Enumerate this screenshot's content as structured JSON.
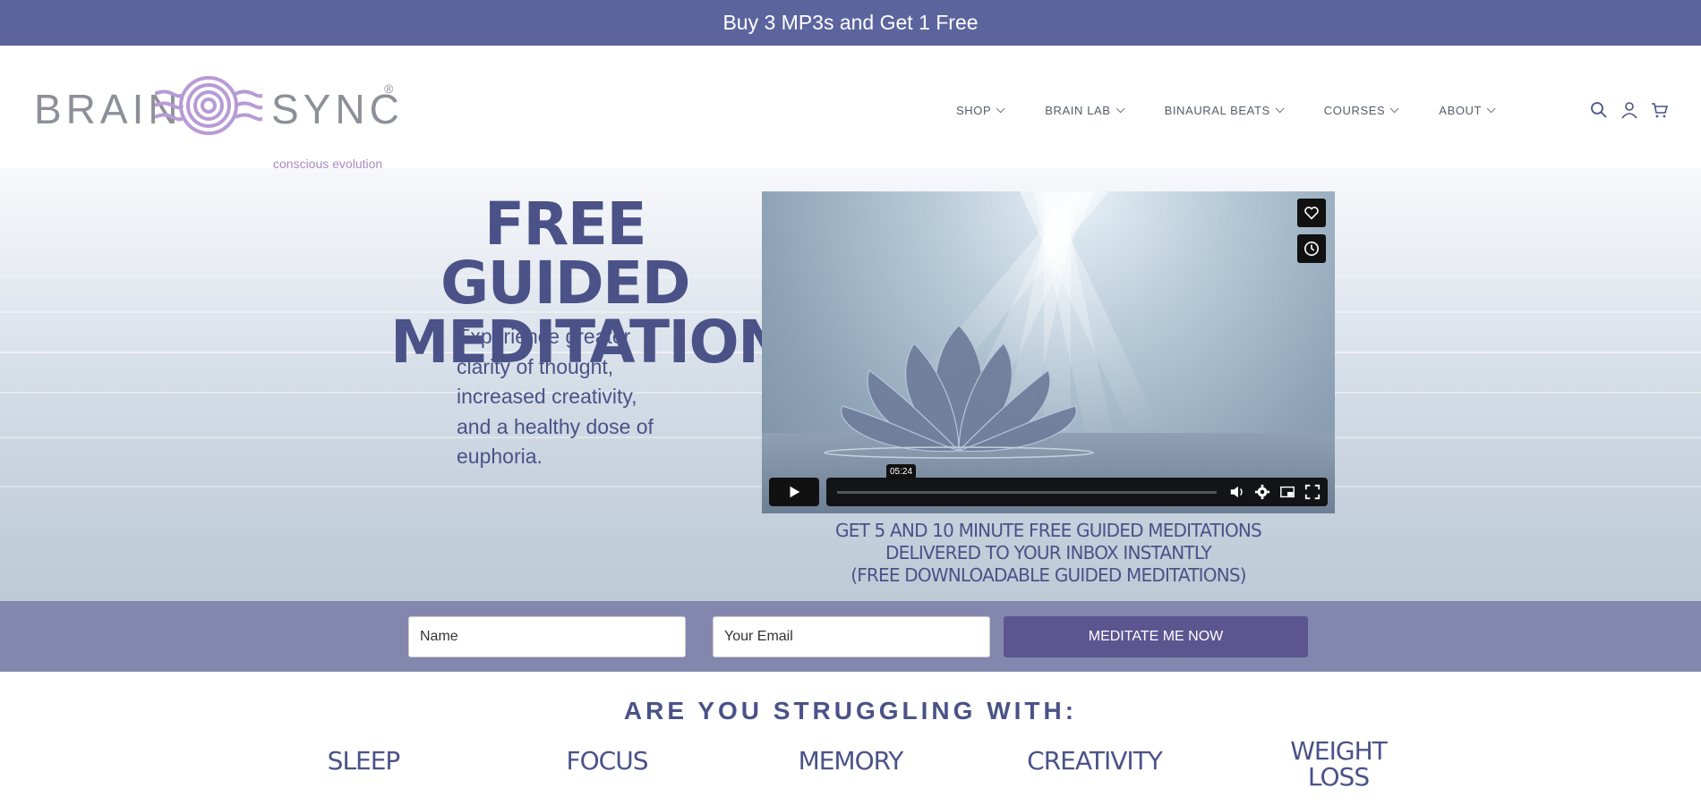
{
  "promo": {
    "text": "Buy 3 MP3s and Get 1 Free"
  },
  "logo": {
    "word1": "BRAIN",
    "word2": "SYNC",
    "reg": "®",
    "tagline": "conscious evolution"
  },
  "nav": [
    {
      "label": "SHOP"
    },
    {
      "label": "BRAIN LAB"
    },
    {
      "label": "BINAURAL BEATS"
    },
    {
      "label": "COURSES"
    },
    {
      "label": "ABOUT"
    }
  ],
  "header_icons": [
    "search-icon",
    "account-icon",
    "cart-icon"
  ],
  "hero": {
    "title_line1": "FREE GUIDED",
    "title_line2": "MEDITATIONS",
    "subtitle_lines": [
      "Experience greater",
      "clarity of thought,",
      "increased creativity,",
      "and a healthy dose of",
      "euphoria."
    ]
  },
  "video": {
    "time": "05:24",
    "side_icons": [
      "heart-icon",
      "clock-icon"
    ],
    "control_icons": [
      "play-icon",
      "volume-icon",
      "settings-icon",
      "pip-icon",
      "fullscreen-icon"
    ]
  },
  "caption": {
    "line1": "GET 5 AND 10 MINUTE FREE GUIDED MEDITATIONS",
    "line2": "DELIVERED TO YOUR INBOX INSTANTLY",
    "line3": "(FREE DOWNLOADABLE GUIDED MEDITATIONS)"
  },
  "form": {
    "name_placeholder": "Name",
    "email_placeholder": "Your Email",
    "submit_label": "MEDITATE ME NOW"
  },
  "struggle": {
    "heading": "ARE YOU STRUGGLING WITH:",
    "topics": [
      "SLEEP",
      "FOCUS",
      "MEMORY",
      "CREATIVITY",
      "WEIGHT",
      "LOSS"
    ]
  },
  "colors": {
    "brand": "#5c649e",
    "text": "#4a5288",
    "strip": "#8387ad",
    "button": "#5c5590"
  }
}
